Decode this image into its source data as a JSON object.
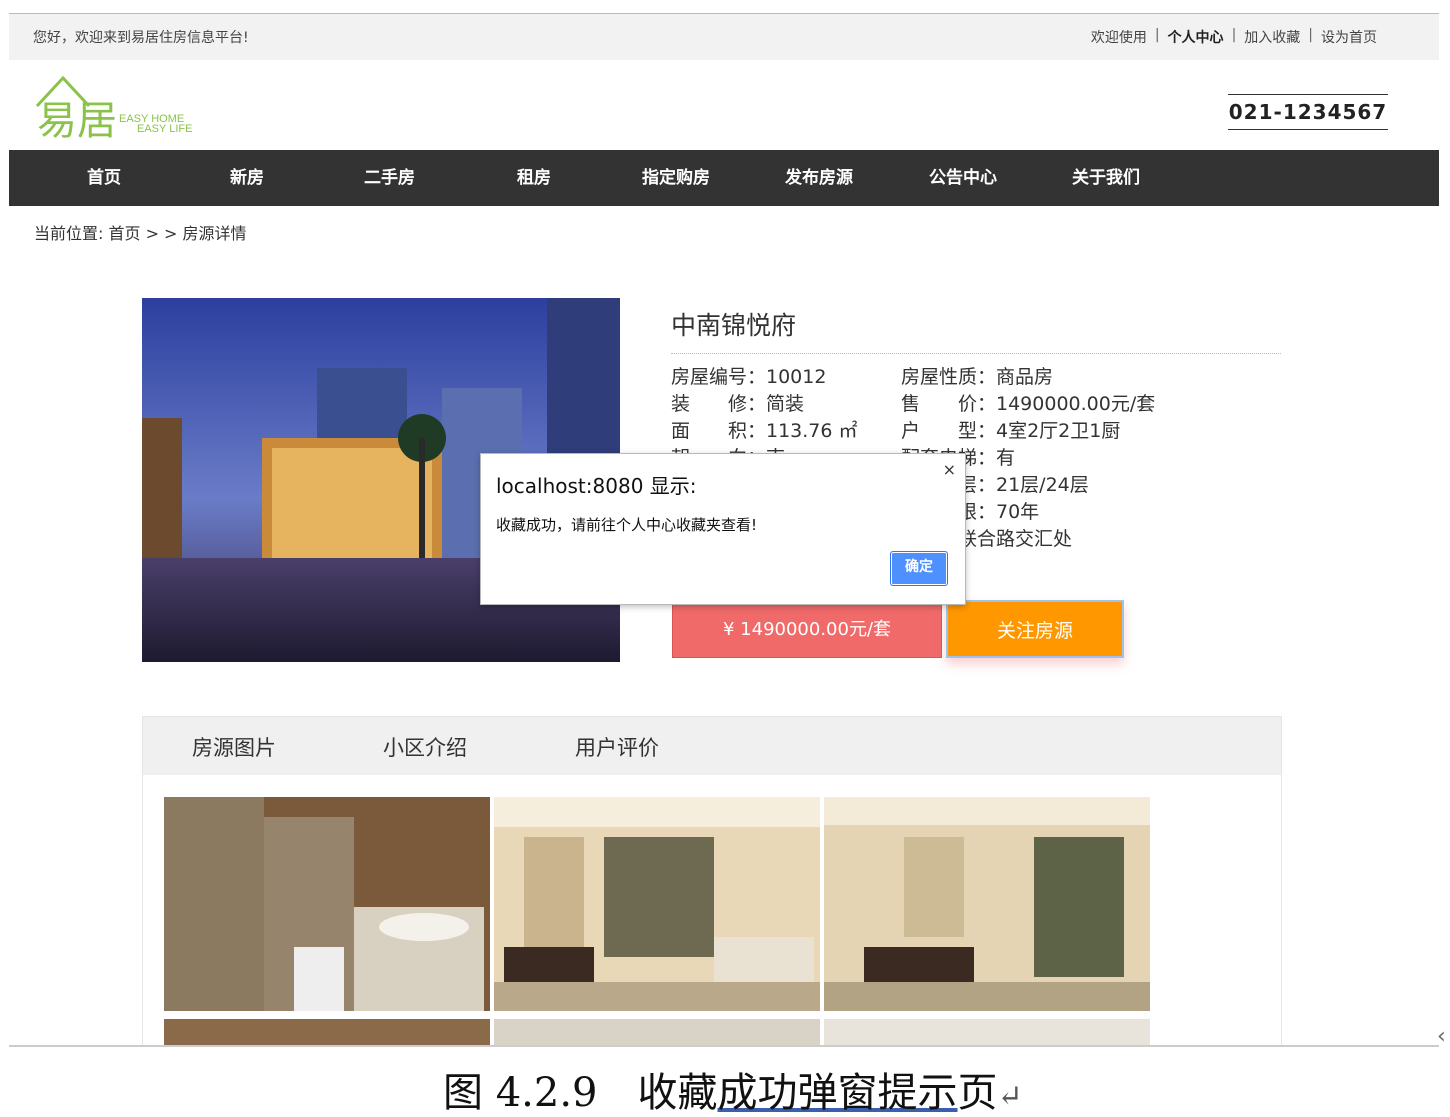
{
  "topbar": {
    "welcome": "您好，欢迎来到易居住房信息平台!",
    "links": [
      "欢迎使用",
      "个人中心",
      "加入收藏",
      "设为首页"
    ],
    "sep": "|"
  },
  "header": {
    "logo_text": "易居",
    "logo_en_1": "EASY HOME",
    "logo_en_2": "EASY LIFE",
    "phone": "021-1234567"
  },
  "nav": [
    "首页",
    "新房",
    "二手房",
    "租房",
    "指定购房",
    "发布房源",
    "公告中心",
    "关于我们"
  ],
  "breadcrumb": "当前位置: 首页 > > 房源详情",
  "property": {
    "title": "中南锦悦府",
    "rows": [
      [
        "房屋编号：10012",
        "房屋性质：商品房"
      ],
      [
        "装　　修：简装",
        "售　　价：1490000.00元/套"
      ],
      [
        "面　　积：113.76 ㎡",
        "户　　型：4室2厅2卫1厨"
      ],
      [
        "朝　　向：南",
        "配套电梯：有"
      ],
      [
        "",
        "楼　　层：21层/24层"
      ],
      [
        "",
        "产权年限：70年"
      ],
      [
        "",
        "地址：联合路交汇处"
      ]
    ],
    "price_button": "¥ 1490000.00元/套",
    "follow_button": "关注房源"
  },
  "tabs": [
    "房源图片",
    "小区介绍",
    "用户评价"
  ],
  "dialog": {
    "title": "localhost:8080 显示:",
    "close": "×",
    "message": "收藏成功，请前往个人中心收藏夹查看!",
    "ok": "确定"
  },
  "caption": {
    "prefix": "图 4.2.9　",
    "text_a": "收藏",
    "text_b": "成功弹窗提示",
    "text_c": "页",
    "ret": "↵"
  },
  "colors": {
    "nav_bg": "#333333",
    "price_btn": "#f06a6a",
    "follow_btn": "#ff9800",
    "dialog_ok": "#4d90fe",
    "logo_green": "#8bc34a"
  }
}
